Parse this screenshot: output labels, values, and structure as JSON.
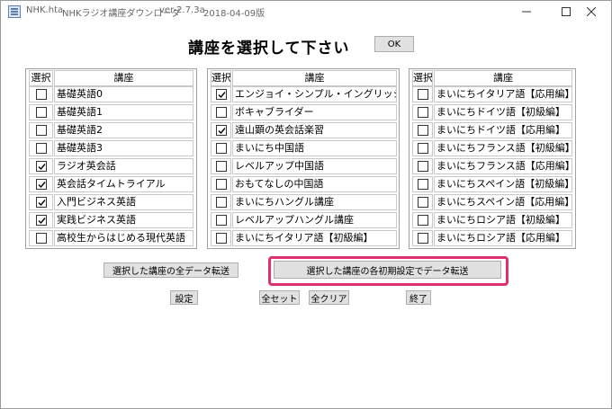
{
  "window": {
    "app_name": "NHK.hta",
    "title": "NHKラジオ講座ダウンローダ",
    "version": "ver-2.7.3a",
    "date": "2018-04-09版",
    "controls": [
      "minimize-icon",
      "maximize-icon",
      "close-icon"
    ]
  },
  "header": {
    "heading": "講座を選択して下さい",
    "ok_label": "OK"
  },
  "table": {
    "col_select": "選択",
    "col_course": "講座",
    "columns": [
      [
        {
          "name": "基礎英語0",
          "checked": false
        },
        {
          "name": "基礎英語1",
          "checked": false
        },
        {
          "name": "基礎英語2",
          "checked": false
        },
        {
          "name": "基礎英語3",
          "checked": false
        },
        {
          "name": "ラジオ英会話",
          "checked": true
        },
        {
          "name": "英会話タイムトライアル",
          "checked": true
        },
        {
          "name": "入門ビジネス英語",
          "checked": true
        },
        {
          "name": "実践ビジネス英語",
          "checked": true
        },
        {
          "name": "高校生からはじめる現代英語",
          "checked": false
        }
      ],
      [
        {
          "name": "エンジョイ・シンプル・イングリッシュ",
          "checked": true
        },
        {
          "name": "ボキャブライダー",
          "checked": false
        },
        {
          "name": "遠山顕の英会話楽習",
          "checked": true
        },
        {
          "name": "まいにち中国語",
          "checked": false
        },
        {
          "name": "レベルアップ中国語",
          "checked": false
        },
        {
          "name": "おもてなしの中国語",
          "checked": false
        },
        {
          "name": "まいにちハングル講座",
          "checked": false
        },
        {
          "name": "レベルアップハングル講座",
          "checked": false
        },
        {
          "name": "まいにちイタリア語【初級編】",
          "checked": false
        }
      ],
      [
        {
          "name": "まいにちイタリア語【応用編】",
          "checked": false
        },
        {
          "name": "まいにちドイツ語【初級編】",
          "checked": false
        },
        {
          "name": "まいにちドイツ語【応用編】",
          "checked": false
        },
        {
          "name": "まいにちフランス語【初級編】",
          "checked": false
        },
        {
          "name": "まいにちフランス語【応用編】",
          "checked": false
        },
        {
          "name": "まいにちスペイン語【初級編】",
          "checked": false
        },
        {
          "name": "まいにちスペイン語【応用編】",
          "checked": false
        },
        {
          "name": "まいにちロシア語【初級編】",
          "checked": false
        },
        {
          "name": "まいにちロシア語【応用編】",
          "checked": false
        }
      ]
    ]
  },
  "actions": {
    "transfer_all": "選択した講座の全データ転送",
    "transfer_initial": "選択した講座の各初期設定でデータ転送",
    "settings": "設定",
    "select_all": "全セット",
    "clear_all": "全クリア",
    "exit": "終了"
  },
  "colors": {
    "highlight": "#e0306f",
    "button_bg": "#e1e1e1"
  }
}
